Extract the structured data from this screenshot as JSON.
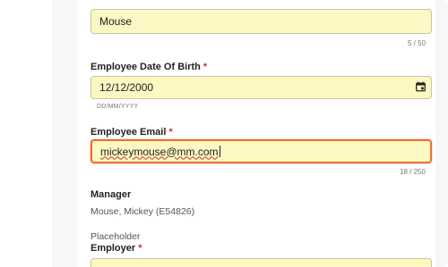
{
  "form": {
    "last_name": {
      "value": "Mouse",
      "counter": "5 / 50"
    },
    "dob": {
      "label": "Employee Date Of Birth",
      "required_mark": "*",
      "value": "12/12/2000",
      "hint": "DD/MM/YYYY",
      "icon": "calendar-icon"
    },
    "email": {
      "label": "Employee Email",
      "required_mark": "*",
      "value": "mickeymouse@mm.com",
      "counter": "18 / 250"
    },
    "manager": {
      "label": "Manager",
      "value": "Mouse, Mickey (E54826)"
    },
    "placeholder_text": "Placeholder",
    "employer": {
      "label": "Employer",
      "required_mark": "*",
      "value": ""
    }
  },
  "colors": {
    "input_bg": "#fdf7c3",
    "focus_border": "#e9722f",
    "required": "#d62c2c"
  }
}
